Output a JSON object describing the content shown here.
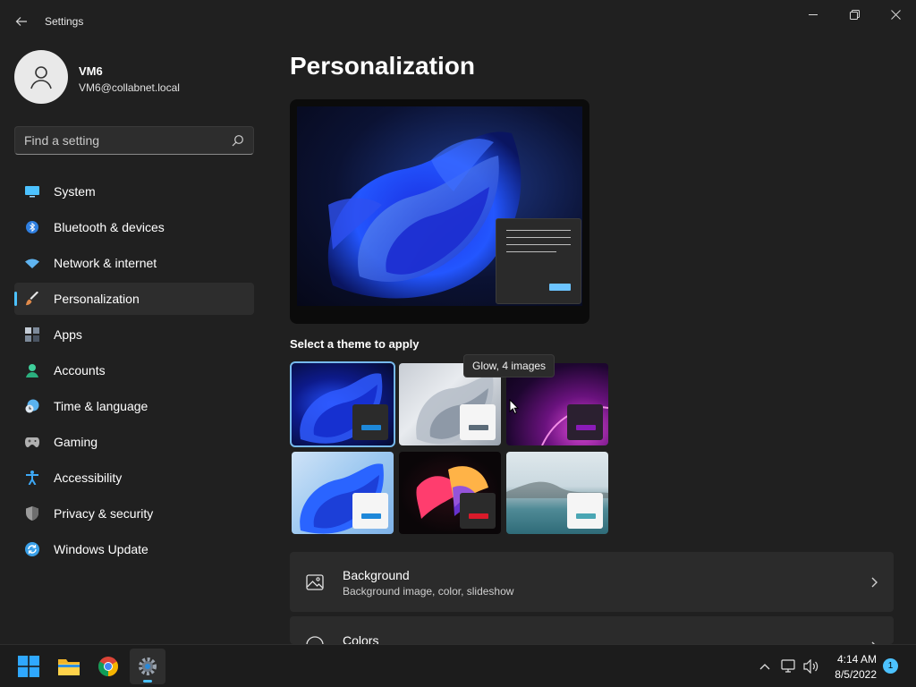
{
  "window": {
    "title": "Settings",
    "back_icon": "back-arrow-icon",
    "minimize_icon": "minimize-icon",
    "restore_icon": "restore-icon",
    "close_icon": "close-icon"
  },
  "profile": {
    "name": "VM6",
    "email": "VM6@collabnet.local",
    "avatar_icon": "person-icon"
  },
  "search": {
    "placeholder": "Find a setting",
    "value": "",
    "icon": "search-icon"
  },
  "sidebar": {
    "items": [
      {
        "label": "System",
        "icon": "system-display-icon",
        "color": "#4cc2ff",
        "active": false
      },
      {
        "label": "Bluetooth & devices",
        "icon": "bluetooth-icon",
        "color": "#3a8fe8",
        "active": false
      },
      {
        "label": "Network & internet",
        "icon": "wifi-icon",
        "color": "#5fb4f0",
        "active": false
      },
      {
        "label": "Personalization",
        "icon": "paintbrush-icon",
        "color": "#e08a4a",
        "active": true
      },
      {
        "label": "Apps",
        "icon": "apps-icon",
        "color": "#9aa5b5",
        "active": false
      },
      {
        "label": "Accounts",
        "icon": "person-icon",
        "color": "#3fcf9b",
        "active": false
      },
      {
        "label": "Time & language",
        "icon": "globe-clock-icon",
        "color": "#5ab3f0",
        "active": false
      },
      {
        "label": "Gaming",
        "icon": "gamepad-icon",
        "color": "#a8a8a8",
        "active": false
      },
      {
        "label": "Accessibility",
        "icon": "accessibility-icon",
        "color": "#3da8f5",
        "active": false
      },
      {
        "label": "Privacy & security",
        "icon": "shield-icon",
        "color": "#9b9b9b",
        "active": false
      },
      {
        "label": "Windows Update",
        "icon": "update-icon",
        "color": "#3aa0e8",
        "active": false
      }
    ]
  },
  "main": {
    "title": "Personalization",
    "theme_section_label": "Select a theme to apply",
    "tooltip": "Glow, 4 images",
    "themes": [
      {
        "id": "windows-dark",
        "selected": true,
        "bar_color": "#1e88d9"
      },
      {
        "id": "windows-light",
        "selected": false,
        "bar_color": "#5b6b78"
      },
      {
        "id": "glow",
        "selected": false,
        "bar_color": "#8a1bb8"
      },
      {
        "id": "windows-bloom-light",
        "selected": false,
        "bar_color": "#1e88d9"
      },
      {
        "id": "captured-motion",
        "selected": false,
        "bar_color": "#d91a2a"
      },
      {
        "id": "flow",
        "selected": false,
        "bar_color": "#4aa6b4"
      }
    ],
    "cards": [
      {
        "title": "Background",
        "subtitle": "Background image, color, slideshow",
        "icon": "image-icon"
      },
      {
        "title": "Colors",
        "subtitle": "",
        "icon": "palette-icon"
      }
    ]
  },
  "taskbar": {
    "apps": [
      {
        "name": "Start",
        "icon": "windows-start-icon"
      },
      {
        "name": "File Explorer",
        "icon": "folder-icon"
      },
      {
        "name": "Google Chrome",
        "icon": "chrome-icon"
      },
      {
        "name": "Settings",
        "icon": "gear-icon",
        "active": true
      }
    ],
    "tray": {
      "chevron_icon": "chevron-up-icon",
      "network_icon": "network-icon",
      "volume_icon": "volume-icon",
      "time": "4:14 AM",
      "date": "8/5/2022",
      "notification_count": "1"
    }
  }
}
